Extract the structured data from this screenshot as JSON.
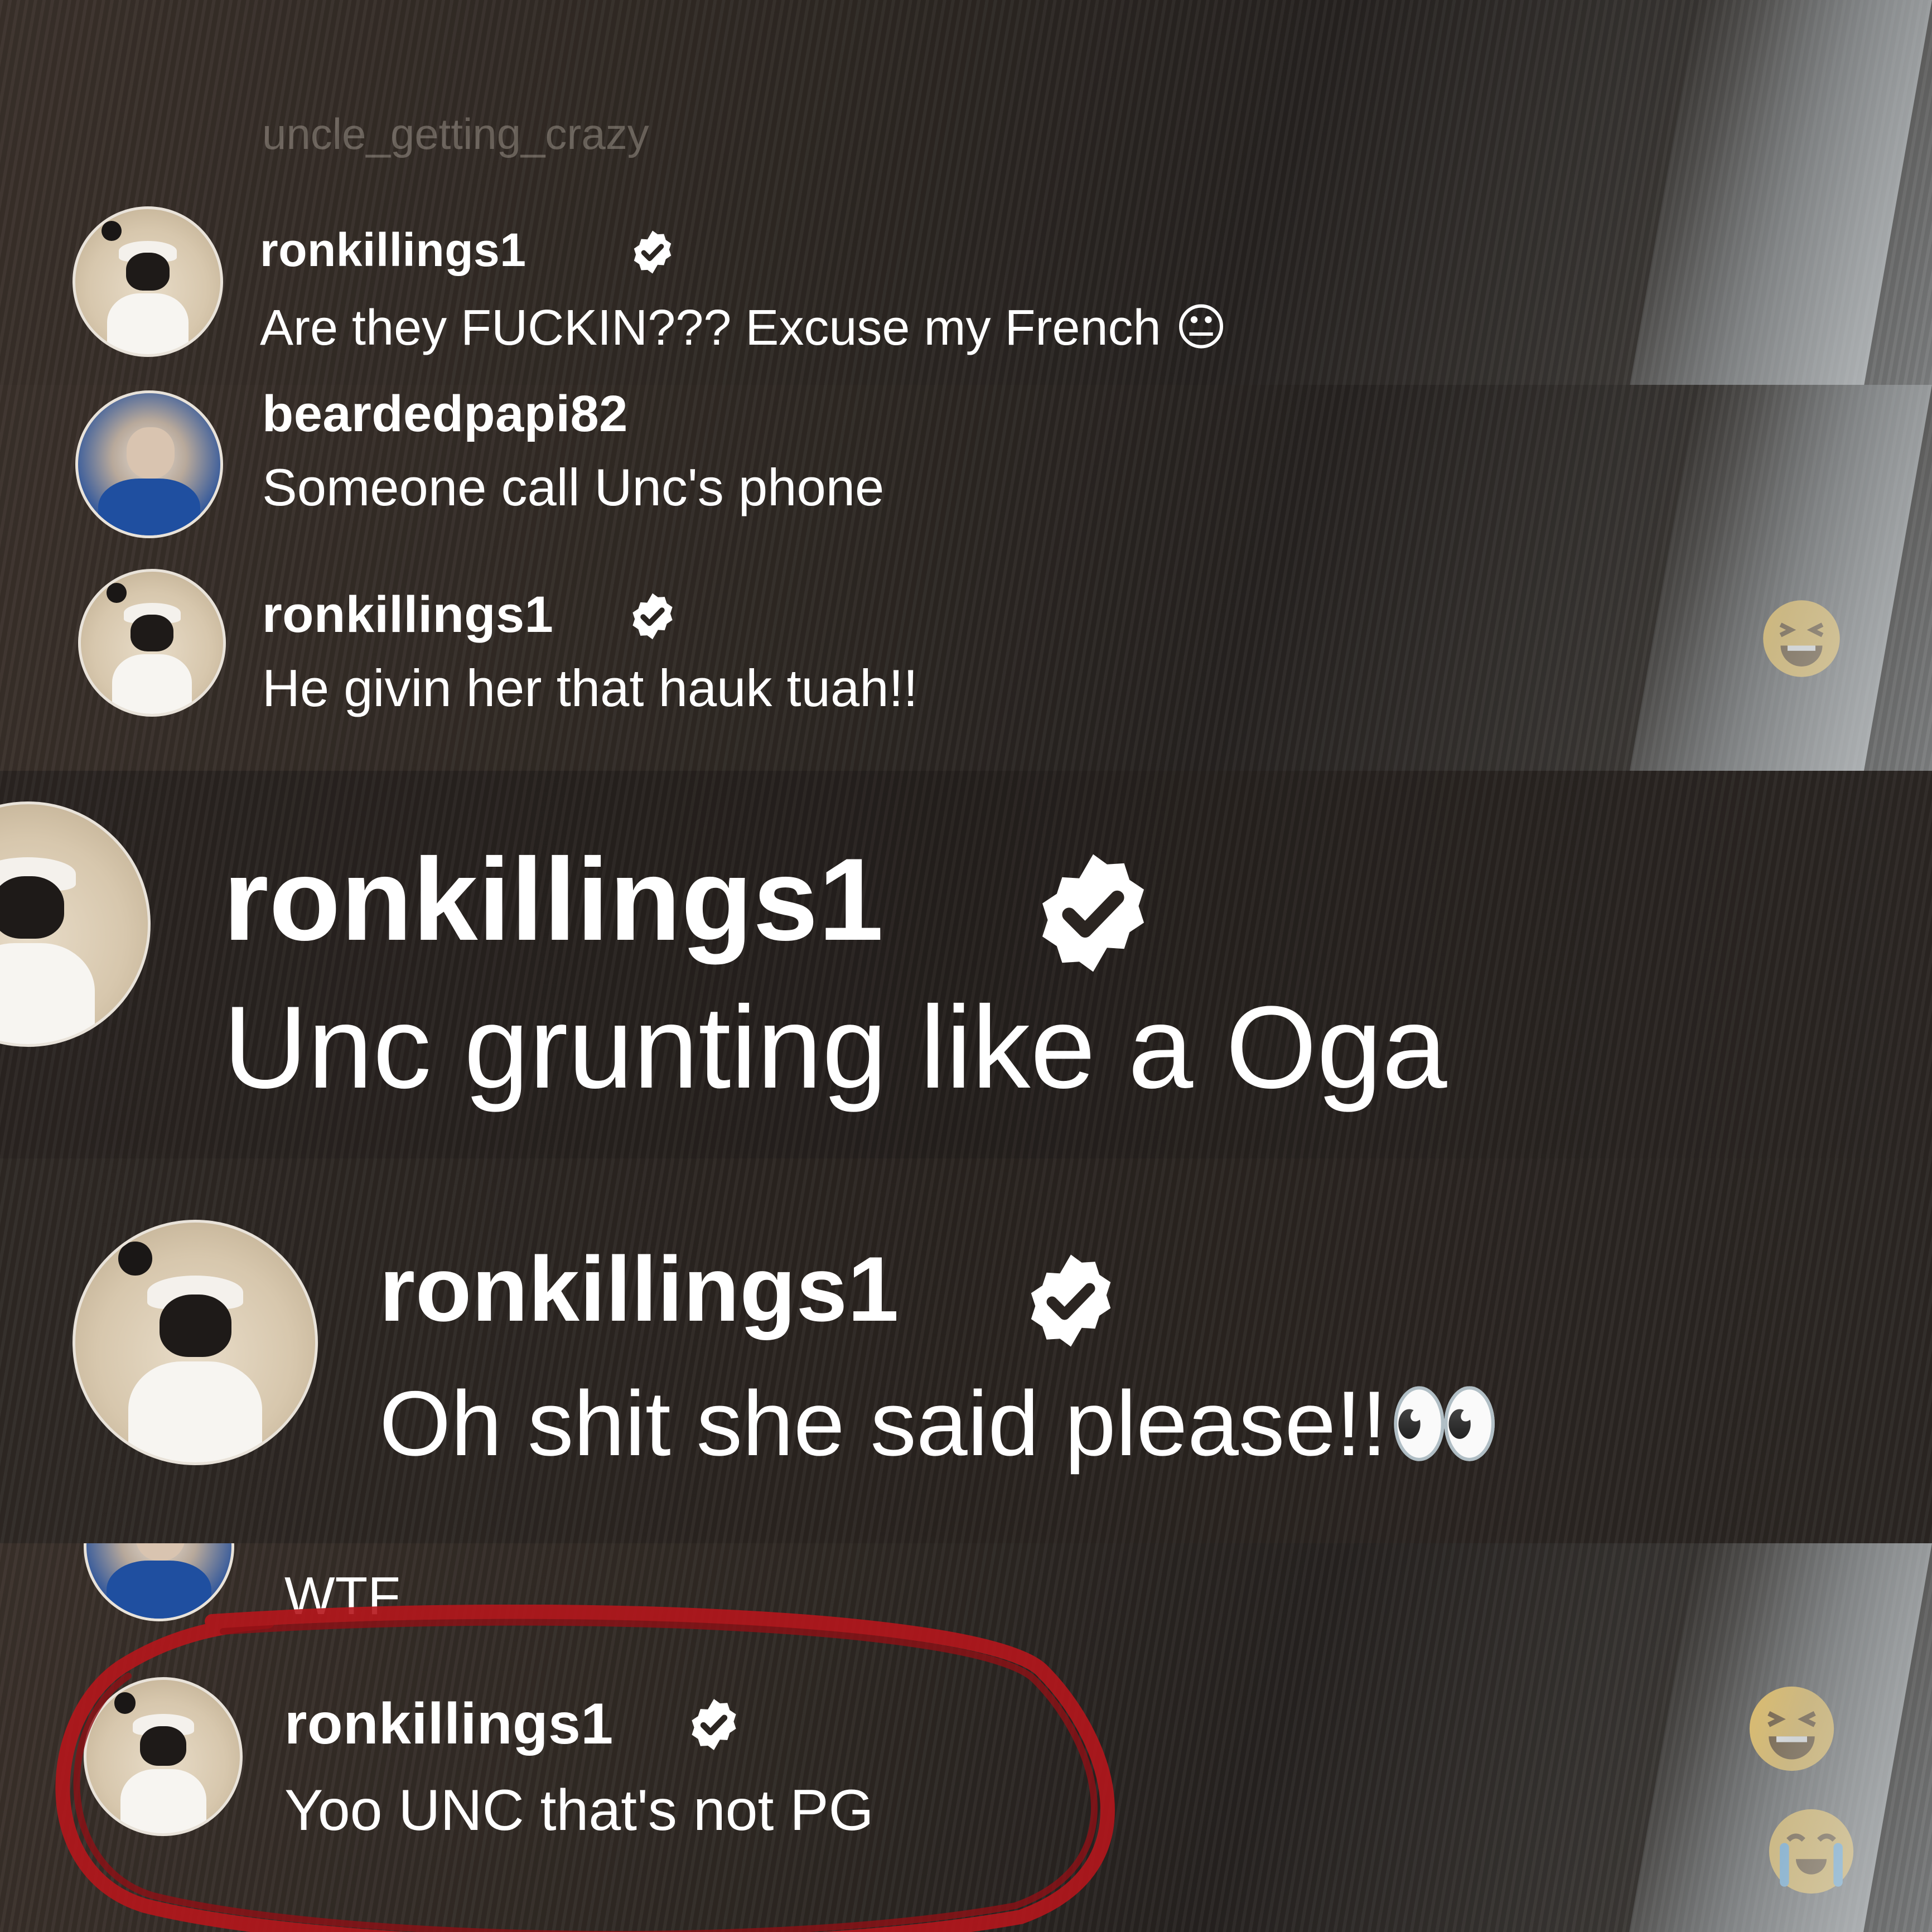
{
  "comments": [
    {
      "username": "uncle_getting_crazy",
      "text": ""
    },
    {
      "username": "ronkillings1",
      "text": "Are they FUCKIN??? Excuse my French 😐"
    },
    {
      "username": "beardedpapi82",
      "text": "Someone call Unc's phone"
    },
    {
      "username": "ronkillings1",
      "text": "He givin her that hauk tuah!!"
    },
    {
      "username": "ronkillings1",
      "text": "Unc grunting like a Oga"
    },
    {
      "username": "ronkillings1",
      "text": "Oh shit she said please!!👀"
    },
    {
      "username": "",
      "text": "WTF"
    },
    {
      "username": "ronkillings1",
      "text": "Yoo UNC that's not PG"
    }
  ],
  "faded_top_text": "uncle_getting_crazy",
  "icons": {
    "verified": "verified-badge-icon",
    "reaction_laugh": "laughing-emoji-icon",
    "reaction_cry": "crying-emoji-icon"
  },
  "colors": {
    "highlight_circle": "#b5161c",
    "verified_fill": "#ffffff",
    "verified_check": "#2b2521",
    "emoji_yellow": "#f3c14a"
  }
}
